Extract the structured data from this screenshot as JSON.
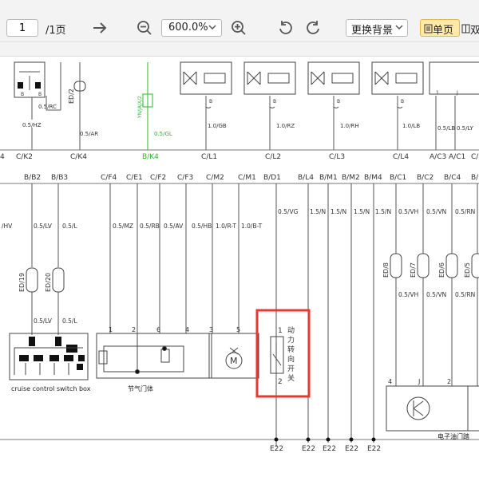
{
  "toolbar": {
    "page_value": "1",
    "page_total": "/1页",
    "zoom": "600.0%",
    "background_label": "更换背景",
    "single_page_label": "单页",
    "double_page_label": "双"
  },
  "schematic": {
    "top_wires": [
      "0.5/HZ",
      "0.5/RC",
      "0.5/AR",
      "0.5/GL",
      "1.0/GB",
      "1.0/RZ",
      "1.0/RH",
      "1.0/LB",
      "0.5/LB",
      "0.5/LY"
    ],
    "top_labels": [
      "ED/2",
      "YN/JAJX/2"
    ],
    "pins": [
      "B",
      "B",
      "B",
      "B",
      "B",
      "B",
      "1",
      "J"
    ],
    "conn_top": [
      "4",
      "C/K2",
      "C/K4",
      "B/K4",
      "C/L1",
      "C/L2",
      "C/L3",
      "C/L4",
      "A/C3",
      "A/C1",
      "C/"
    ],
    "conn_mid": [
      "B/B2",
      "B/B3",
      "C/F4",
      "C/E1",
      "C/F2",
      "C/F3",
      "C/M2",
      "C/M1",
      "B/D1",
      "B/L4",
      "B/M1",
      "B/M2",
      "B/M4",
      "B/C1",
      "B/C2",
      "B/C4",
      "B/"
    ],
    "mid_wires": [
      "/HV",
      "0.5/LV",
      "0.5/L",
      "0.5/MZ",
      "0.5/RB",
      "0.5/AV",
      "0.5/HB",
      "1.0/R-T",
      "1.0/B-T",
      "0.5/VG",
      "1.5/N",
      "1.5/N",
      "1.5/N",
      "1.5/N",
      "0.5/VH",
      "0.5/VN",
      "0.5/RN"
    ],
    "ed_labels": [
      "ED/19",
      "ED/20",
      "ED/8",
      "ED/7",
      "ED/6",
      "ED/5"
    ],
    "lower_wires": [
      "0.5/LV",
      "0.5/L",
      "0.5/VH",
      "0.5/VN",
      "0.5/RN"
    ],
    "throttle_pins": [
      "1",
      "2",
      "6",
      "4",
      "3",
      "5"
    ],
    "motor_label": "M",
    "switch_pins": [
      "1",
      "2"
    ],
    "switch_name": [
      "动",
      "力",
      "转",
      "向",
      "开",
      "关"
    ],
    "cruise_label": "cruise control switch box",
    "throttle_label": "节气门体",
    "pedal_label": "电子油门踏",
    "right_pins": [
      "4",
      "J",
      "2"
    ],
    "ground": [
      "E22",
      "E22",
      "E22",
      "E22",
      "E22",
      "E22"
    ]
  },
  "colors": {
    "accent_highlight": "#e53935",
    "green_wire": "#2fb52f",
    "toolbar_bg": "#f3f3f3",
    "single_page_active": "#ffe9a8"
  },
  "icons": [
    "arrow-right-icon",
    "zoom-out-icon",
    "zoom-in-icon",
    "rotate-left-icon",
    "rotate-right-icon",
    "chevron-down-icon",
    "single-page-icon",
    "double-page-icon"
  ]
}
